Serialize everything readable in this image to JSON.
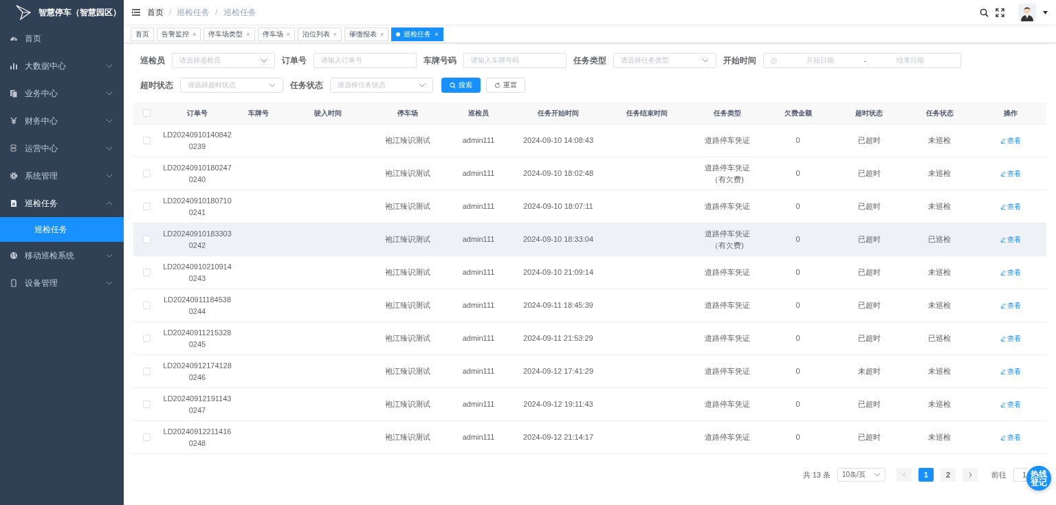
{
  "brand": {
    "title": "智慧停车（智慧园区）"
  },
  "sidebar": {
    "items": [
      {
        "label": "首页",
        "has_children": false,
        "expanded": false
      },
      {
        "label": "大数据中心",
        "has_children": true,
        "expanded": false
      },
      {
        "label": "业务中心",
        "has_children": true,
        "expanded": false
      },
      {
        "label": "财务中心",
        "has_children": true,
        "expanded": false
      },
      {
        "label": "运营中心",
        "has_children": true,
        "expanded": false
      },
      {
        "label": "系统管理",
        "has_children": true,
        "expanded": false
      },
      {
        "label": "巡检任务",
        "has_children": true,
        "expanded": true,
        "children": [
          {
            "label": "巡检任务",
            "selected": true
          }
        ]
      },
      {
        "label": "移动巡检系统",
        "has_children": true,
        "expanded": false
      },
      {
        "label": "设备管理",
        "has_children": true,
        "expanded": false
      }
    ]
  },
  "breadcrumb": {
    "separator": "/",
    "items": [
      "首页",
      "巡检任务",
      "巡检任务"
    ]
  },
  "tags": [
    {
      "label": "首页",
      "selected": false
    },
    {
      "label": "告警监控",
      "close": "×",
      "selected": false
    },
    {
      "label": "停车场类型",
      "close": "×",
      "selected": false
    },
    {
      "label": "停车场",
      "close": "×",
      "selected": false
    },
    {
      "label": "泊位列表",
      "close": "×",
      "selected": false
    },
    {
      "label": "催缴报表",
      "close": "×",
      "selected": false
    },
    {
      "label": "巡检任务",
      "close": "×",
      "selected": true
    }
  ],
  "filters": [
    {
      "kind": "select",
      "label": "巡检员",
      "placeholder": "请选择巡检员"
    },
    {
      "kind": "input",
      "label": "订单号",
      "placeholder": "请输入订单号"
    },
    {
      "kind": "input",
      "label": "车牌号码",
      "placeholder": "请输入车牌号码"
    },
    {
      "kind": "select",
      "label": "任务类型",
      "placeholder": "请选择任务类型"
    },
    {
      "kind": "daterange",
      "label": "开始时间",
      "placeholder": "开始日期",
      "placeholder_end": "结束日期",
      "separator": "-"
    },
    {
      "kind": "select",
      "label": "超时状态",
      "placeholder": "请选择超时状态"
    },
    {
      "kind": "select",
      "label": "任务状态",
      "placeholder": "请选择任务状态"
    }
  ],
  "buttons": [
    {
      "kind": "primary",
      "label": "搜索"
    },
    {
      "kind": "plain",
      "label": "重置"
    }
  ],
  "table": {
    "all_checked": false,
    "columns": [
      "订单号",
      "车牌号",
      "驶入时间",
      "停车场",
      "巡检员",
      "任务开始时间",
      "任务结束时间",
      "任务类型",
      "欠费金额",
      "超时状态",
      "任务状态",
      "操作"
    ],
    "rows": [
      {
        "checked": false,
        "highlighted": false,
        "order": "LD202409101408420239",
        "lot": "袍江臻识测试",
        "inspector": "admin111",
        "start": "2024-09-10 14:08:43",
        "type": "道路停车凭证",
        "arrears": "0",
        "timeout": "已超时",
        "status": "未巡检",
        "action": "查看"
      },
      {
        "checked": false,
        "highlighted": false,
        "order": "LD202409101802470240",
        "lot": "袍江臻识测试",
        "inspector": "admin111",
        "start": "2024-09-10 18:02:48",
        "type": "道路停车凭证（有欠费)",
        "arrears": "0",
        "timeout": "已超时",
        "status": "未巡检",
        "action": "查看"
      },
      {
        "checked": false,
        "highlighted": false,
        "order": "LD202409101807100241",
        "lot": "袍江臻识测试",
        "inspector": "admin111",
        "start": "2024-09-10 18:07:11",
        "type": "道路停车凭证",
        "arrears": "0",
        "timeout": "已超时",
        "status": "未巡检",
        "action": "查看"
      },
      {
        "checked": false,
        "highlighted": true,
        "order": "LD202409101833030242",
        "lot": "袍江臻识测试",
        "inspector": "admin111",
        "start": "2024-09-10 18:33:04",
        "type": "道路停车凭证（有欠费)",
        "arrears": "0",
        "timeout": "已超时",
        "status": "已巡检",
        "action": "查看"
      },
      {
        "checked": false,
        "highlighted": false,
        "order": "LD202409102109140243",
        "lot": "袍江臻识测试",
        "inspector": "admin111",
        "start": "2024-09-10 21:09:14",
        "type": "道路停车凭证",
        "arrears": "0",
        "timeout": "已超时",
        "status": "未巡检",
        "action": "查看"
      },
      {
        "checked": false,
        "highlighted": false,
        "order": "LD202409111845380244",
        "lot": "袍江臻识测试",
        "inspector": "admin111",
        "start": "2024-09-11 18:45:39",
        "type": "道路停车凭证",
        "arrears": "0",
        "timeout": "已超时",
        "status": "未巡检",
        "action": "查看"
      },
      {
        "checked": false,
        "highlighted": false,
        "order": "LD202409112153280245",
        "lot": "袍江臻识测试",
        "inspector": "admin111",
        "start": "2024-09-11 21:53:29",
        "type": "道路停车凭证",
        "arrears": "0",
        "timeout": "已超时",
        "status": "已巡检",
        "action": "查看"
      },
      {
        "checked": false,
        "highlighted": false,
        "order": "LD202409121741280246",
        "lot": "袍江臻识测试",
        "inspector": "admin111",
        "start": "2024-09-12 17:41:29",
        "type": "道路停车凭证",
        "arrears": "0",
        "timeout": "未超时",
        "status": "未巡检",
        "action": "查看"
      },
      {
        "checked": false,
        "highlighted": false,
        "order": "LD202409121911430247",
        "lot": "袍江臻识测试",
        "inspector": "admin111",
        "start": "2024-09-12 19:11:43",
        "type": "道路停车凭证",
        "arrears": "0",
        "timeout": "已超时",
        "status": "未巡检",
        "action": "查看"
      },
      {
        "checked": false,
        "highlighted": false,
        "order": "LD202409122114160248",
        "lot": "袍江臻识测试",
        "inspector": "admin111",
        "start": "2024-09-12 21:14:17",
        "type": "道路停车凭证",
        "arrears": "0",
        "timeout": "已超时",
        "status": "未巡检",
        "action": "查看"
      }
    ]
  },
  "pagination": {
    "total": "共 13 条",
    "page_size": "10条/页",
    "pages": [
      {
        "label": "1",
        "selected": true
      },
      {
        "label": "2",
        "selected": false
      }
    ],
    "goto_label": "前往",
    "goto_value": "1"
  },
  "float_button": "热线登记"
}
